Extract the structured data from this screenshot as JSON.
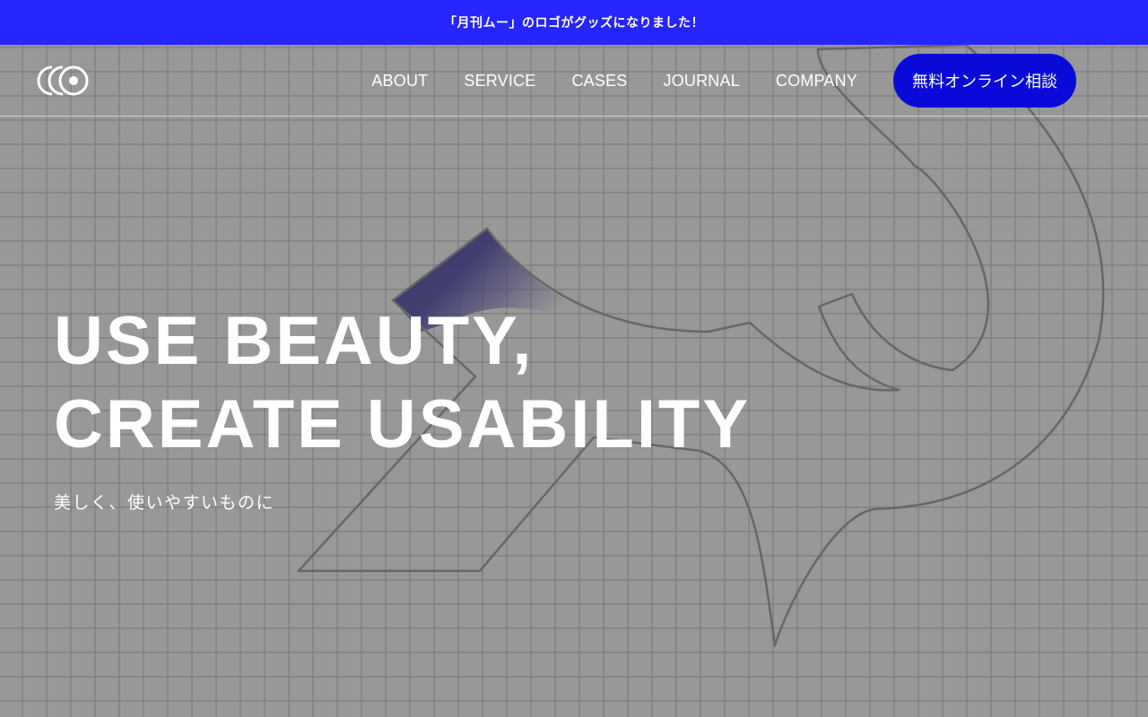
{
  "announcement": {
    "text": "「月刊ムー」のロゴがグッズになりました！"
  },
  "brand": {
    "logo_icon": "triple-circle-logo-icon"
  },
  "nav": {
    "items": [
      {
        "label": "ABOUT"
      },
      {
        "label": "SERVICE"
      },
      {
        "label": "CASES"
      },
      {
        "label": "JOURNAL"
      },
      {
        "label": "COMPANY"
      }
    ],
    "cta_label": "無料オンライン相談"
  },
  "hero": {
    "headline_line1": "USE BEAUTY,",
    "headline_line2": "CREATE USABILITY",
    "subline": "美しく、使いやすいものに"
  },
  "colors": {
    "announcement_bg": "#2525ff",
    "cta_bg": "#0a0ad8",
    "page_bg": "#989898",
    "accent_gradient": "#3e3a6e"
  }
}
